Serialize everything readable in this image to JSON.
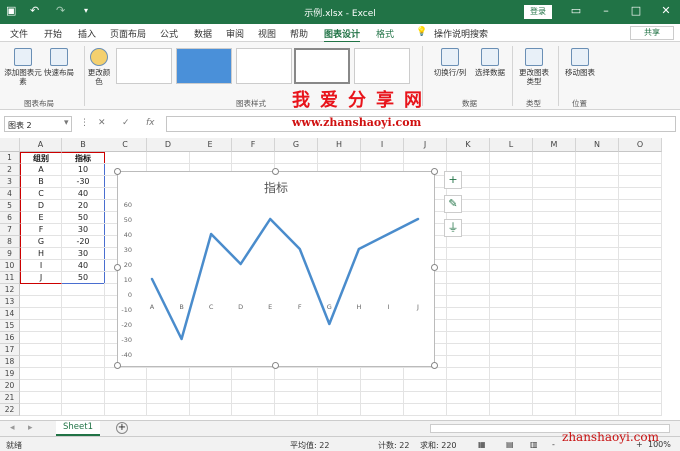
{
  "app": {
    "title": "示例.xlsx  -  Excel",
    "login": "登录"
  },
  "tabs": [
    "文件",
    "开始",
    "插入",
    "页面布局",
    "公式",
    "数据",
    "审阅",
    "视图",
    "帮助",
    "图表设计",
    "格式"
  ],
  "search": "操作说明搜索",
  "share": "共享",
  "ribbon": {
    "add_element": "添加图表元素",
    "quick_layout": "快速布局",
    "change_color": "更改颜色",
    "group_layout": "图表布局",
    "group_styles": "图表样式",
    "switch_rowcol": "切换行/列",
    "select_data": "选择数据",
    "group_data": "数据",
    "change_type": "更改图表类型",
    "group_type": "类型",
    "move_chart": "移动图表",
    "group_location": "位置"
  },
  "watermark": {
    "cn": "我爱分享网",
    "url": "www.zhanshaoyi.com",
    "url2": "zhanshaoyi.com"
  },
  "formula": {
    "namebox": "图表 2",
    "fx": "fx"
  },
  "columns": [
    "A",
    "B",
    "C",
    "D",
    "E",
    "F",
    "G",
    "H",
    "I",
    "J",
    "K",
    "L",
    "M",
    "N",
    "O"
  ],
  "rows": [
    "1",
    "2",
    "3",
    "4",
    "5",
    "6",
    "7",
    "8",
    "9",
    "10",
    "11",
    "12",
    "13",
    "14",
    "15",
    "16",
    "17",
    "18",
    "19",
    "20",
    "21",
    "22"
  ],
  "table": {
    "h1": "组别",
    "h2": "指标",
    "data": [
      [
        "A",
        "10"
      ],
      [
        "B",
        "-30"
      ],
      [
        "C",
        "40"
      ],
      [
        "D",
        "20"
      ],
      [
        "E",
        "50"
      ],
      [
        "F",
        "30"
      ],
      [
        "G",
        "-20"
      ],
      [
        "H",
        "30"
      ],
      [
        "I",
        "40"
      ],
      [
        "J",
        "50"
      ]
    ]
  },
  "chart_data": {
    "type": "line",
    "title": "指标",
    "categories": [
      "A",
      "B",
      "C",
      "D",
      "E",
      "F",
      "G",
      "H",
      "I",
      "J"
    ],
    "values": [
      10,
      -30,
      40,
      20,
      50,
      30,
      -20,
      30,
      40,
      50
    ],
    "ylim": [
      -40,
      60
    ],
    "yticks": [
      "60",
      "50",
      "40",
      "30",
      "20",
      "10",
      "0",
      "-10",
      "-20",
      "-30",
      "-40"
    ],
    "color": "#4a8ccc",
    "grid": false,
    "legend": "none"
  },
  "sheet": {
    "name": "Sheet1",
    "add": "+"
  },
  "status": {
    "ready": "就绪",
    "avg": "平均值: 22",
    "count": "计数: 22",
    "sum": "求和: 220",
    "zoom": "100%",
    "minus": "-",
    "plus": "+"
  }
}
